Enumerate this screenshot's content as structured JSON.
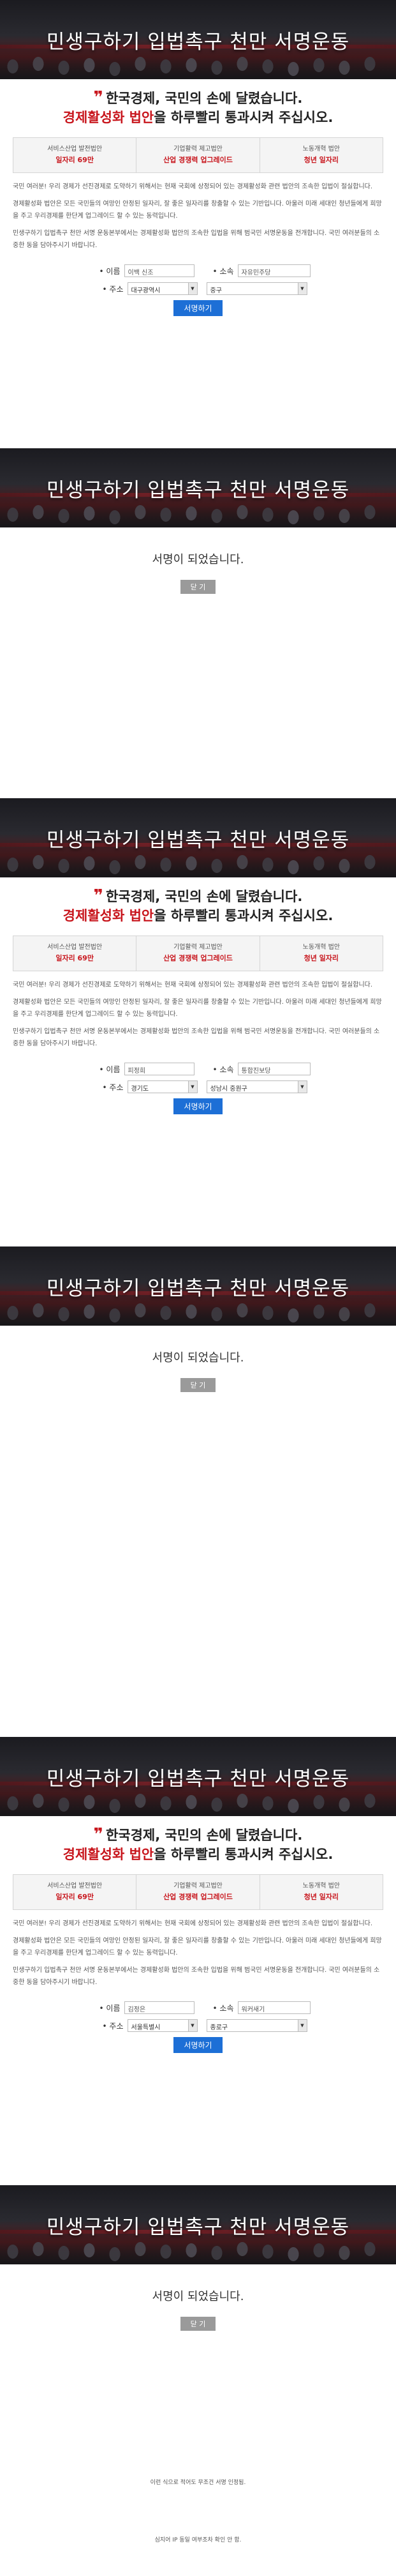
{
  "banner_title": "민생구하기 입법촉구 천만 서명운동",
  "headline_line1": "한국경제, 국민의 손에 달렸습니다.",
  "headline_line2_highlight": "경제활성화 법안",
  "headline_line2_rest": "을 하루빨리 통과시켜 주십시오.",
  "goals": [
    {
      "small": "서비스산업 발전법안",
      "big": "일자리 69만"
    },
    {
      "small": "기업활력 제고법안",
      "big": "산업 경쟁력 업그레이드"
    },
    {
      "small": "노동개혁 법안",
      "big": "청년 일자리"
    }
  ],
  "paragraphs": [
    "국민 여러분! 우리 경제가 선진경제로 도약하기 위해서는 현재 국회에 상정되어 있는 경제활성화 관련 법안의 조속한 입법이 절실합니다.",
    "경제활성화 법안은 모든 국민들의 여망인 안정된 일자리, 잘 좋은 일자리를 창출할 수 있는 기반입니다. 아울러 미래 세대인 청년들에게 희망을 주고 우리경제를 한단계 업그레이드 할 수 있는 동력입니다.",
    "민생구하기 입법촉구 천만 서명 운동본부에서는 경제활성화 법안의 조속한 입법을 위해 범국민 서명운동을 전개합니다. 국민 여러분들의 소중한 동을 담아주시기 바랍니다."
  ],
  "form_labels": {
    "name": "• 이름",
    "affiliation": "• 소속",
    "address": "• 주소"
  },
  "submit_label": "서명하기",
  "done_message": "서명이 되었습니다.",
  "close_label": "닫 기",
  "submissions": [
    {
      "name": "이백 신조",
      "affiliation": "자유민주당",
      "city": "대구광역시",
      "district": "중구"
    },
    {
      "name": "피정희",
      "affiliation": "통합진보당",
      "city": "경기도",
      "district": "성남시 중원구"
    },
    {
      "name": "김정은",
      "affiliation": "워커새기",
      "city": "서울특별시",
      "district": "종로구"
    }
  ],
  "footer_line1": "이런 식으로 적어도 무조건 서명 인정됨.",
  "footer_line2": "심지어 IP 동일 여부조차 확인 안 함."
}
